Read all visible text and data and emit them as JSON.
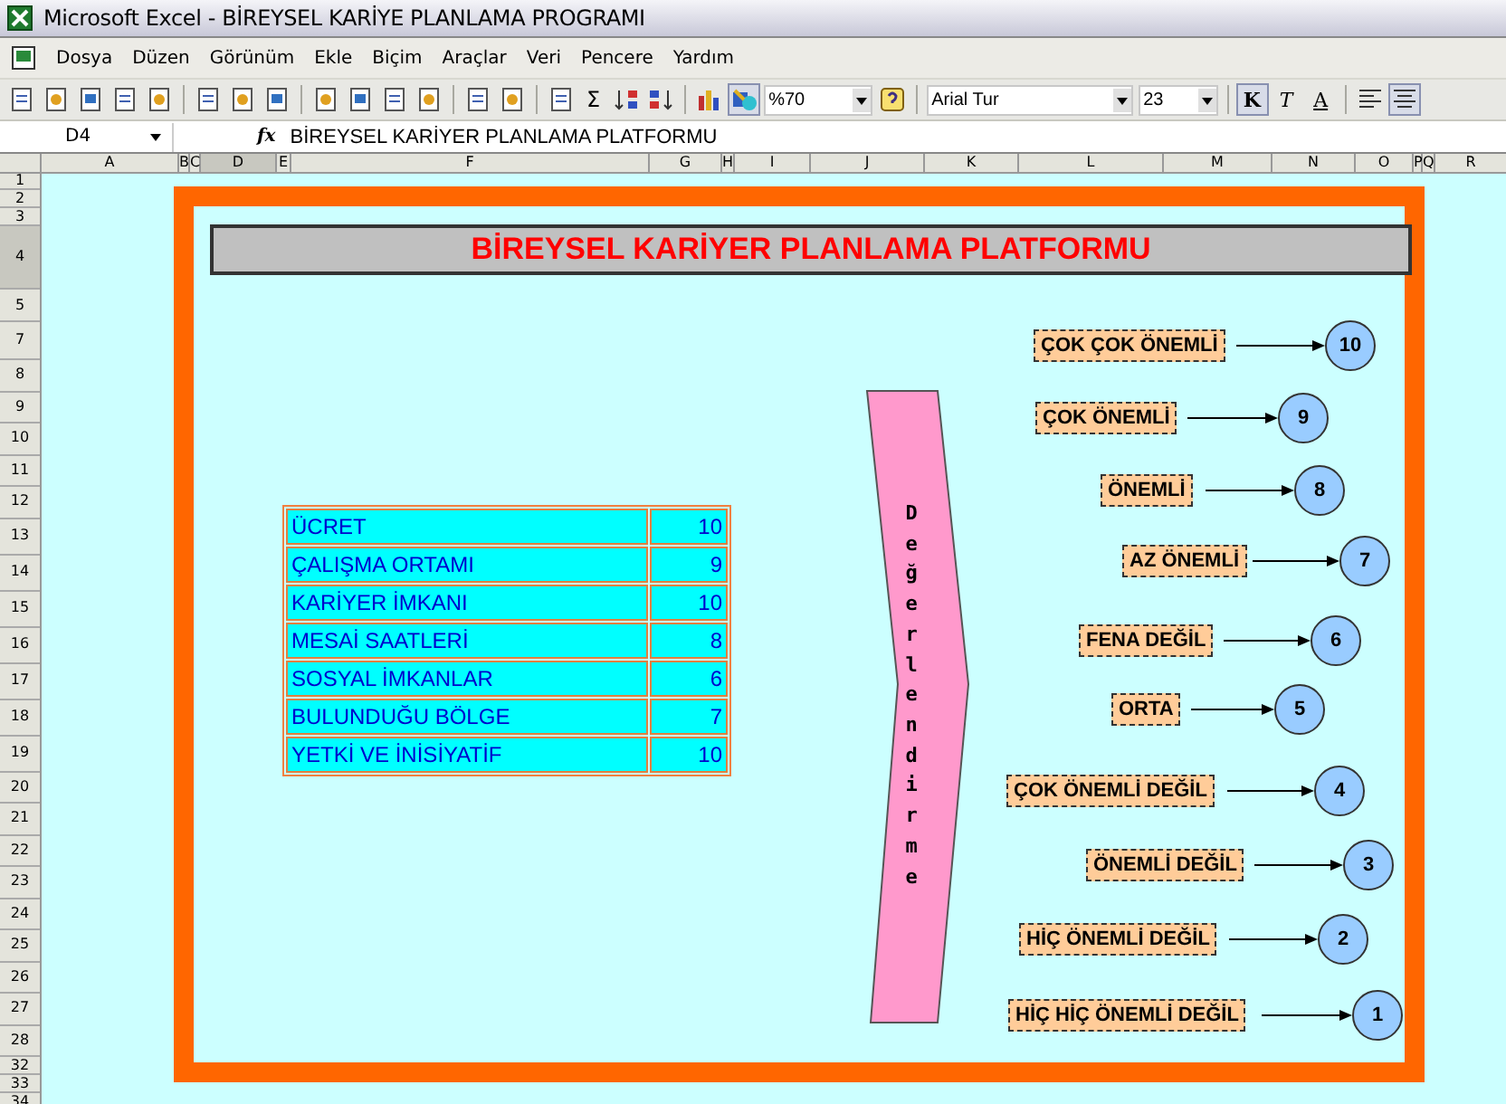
{
  "window": {
    "title": "Microsoft Excel - BİREYSEL KARİYE PLANLAMA PROGRAMI"
  },
  "menu": [
    "Dosya",
    "Düzen",
    "Görünüm",
    "Ekle",
    "Biçim",
    "Araçlar",
    "Veri",
    "Pencere",
    "Yardım"
  ],
  "toolbar": {
    "sum": "Σ",
    "zoom": "%70",
    "font": "Arial Tur",
    "size": "23",
    "bold": "K",
    "italic": "T",
    "underline": "A"
  },
  "formula_bar": {
    "name_box": "D4",
    "fx": "fx",
    "value": "BİREYSEL KARİYER PLANLAMA PLATFORMU"
  },
  "columns": [
    {
      "label": "A",
      "selected": false
    },
    {
      "label": "B",
      "selected": false
    },
    {
      "label": "C",
      "selected": false
    },
    {
      "label": "D",
      "selected": true
    },
    {
      "label": "E",
      "selected": false
    },
    {
      "label": "F",
      "selected": false
    },
    {
      "label": "G",
      "selected": false
    },
    {
      "label": "H",
      "selected": false
    },
    {
      "label": "I",
      "selected": false
    },
    {
      "label": "J",
      "selected": false
    },
    {
      "label": "K",
      "selected": false
    },
    {
      "label": "L",
      "selected": false
    },
    {
      "label": "M",
      "selected": false
    },
    {
      "label": "N",
      "selected": false
    },
    {
      "label": "O",
      "selected": false
    },
    {
      "label": "P",
      "selected": false
    },
    {
      "label": "Q",
      "selected": false
    },
    {
      "label": "R",
      "selected": false
    }
  ],
  "rows": [
    {
      "label": "1",
      "selected": false
    },
    {
      "label": "2",
      "selected": false
    },
    {
      "label": "3",
      "selected": false
    },
    {
      "label": "4",
      "selected": true
    },
    {
      "label": "5",
      "selected": false
    },
    {
      "label": "7",
      "selected": false
    },
    {
      "label": "8",
      "selected": false
    },
    {
      "label": "9",
      "selected": false
    },
    {
      "label": "10",
      "selected": false
    },
    {
      "label": "11",
      "selected": false
    },
    {
      "label": "12",
      "selected": false
    },
    {
      "label": "13",
      "selected": false
    },
    {
      "label": "14",
      "selected": false
    },
    {
      "label": "15",
      "selected": false
    },
    {
      "label": "16",
      "selected": false
    },
    {
      "label": "17",
      "selected": false
    },
    {
      "label": "18",
      "selected": false
    },
    {
      "label": "19",
      "selected": false
    },
    {
      "label": "20",
      "selected": false
    },
    {
      "label": "21",
      "selected": false
    },
    {
      "label": "22",
      "selected": false
    },
    {
      "label": "23",
      "selected": false
    },
    {
      "label": "24",
      "selected": false
    },
    {
      "label": "25",
      "selected": false
    },
    {
      "label": "26",
      "selected": false
    },
    {
      "label": "27",
      "selected": false
    },
    {
      "label": "28",
      "selected": false
    },
    {
      "label": "32",
      "selected": false
    },
    {
      "label": "33",
      "selected": false
    },
    {
      "label": "34",
      "selected": false
    }
  ],
  "sheet": {
    "title": "BİREYSEL KARİYER PLANLAMA PLATFORMU",
    "criteria": [
      {
        "name": "ÜCRET",
        "score": "10"
      },
      {
        "name": "ÇALIŞMA ORTAMI",
        "score": "9"
      },
      {
        "name": "KARİYER İMKANI",
        "score": "10"
      },
      {
        "name": "MESAİ SAATLERİ",
        "score": "8"
      },
      {
        "name": "SOSYAL İMKANLAR",
        "score": "6"
      },
      {
        "name": "BULUNDUĞU BÖLGE",
        "score": "7"
      },
      {
        "name": "YETKİ VE İNİSİYATİF",
        "score": "10"
      }
    ],
    "evaluation_label": "Değerlendirme",
    "scale": [
      {
        "label": "ÇOK ÇOK ÖNEMLİ",
        "value": "10"
      },
      {
        "label": "ÇOK ÖNEMLİ",
        "value": "9"
      },
      {
        "label": "ÖNEMLİ",
        "value": "8"
      },
      {
        "label": "AZ ÖNEMLİ",
        "value": "7"
      },
      {
        "label": "FENA DEĞİL",
        "value": "6"
      },
      {
        "label": "ORTA",
        "value": "5"
      },
      {
        "label": "ÇOK ÖNEMLİ DEĞİL",
        "value": "4"
      },
      {
        "label": "ÖNEMLİ DEĞİL",
        "value": "3"
      },
      {
        "label": "HİÇ ÖNEMLİ DEĞİL",
        "value": "2"
      },
      {
        "label": "HİÇ HİÇ ÖNEMLİ DEĞİL",
        "value": "1"
      }
    ]
  }
}
